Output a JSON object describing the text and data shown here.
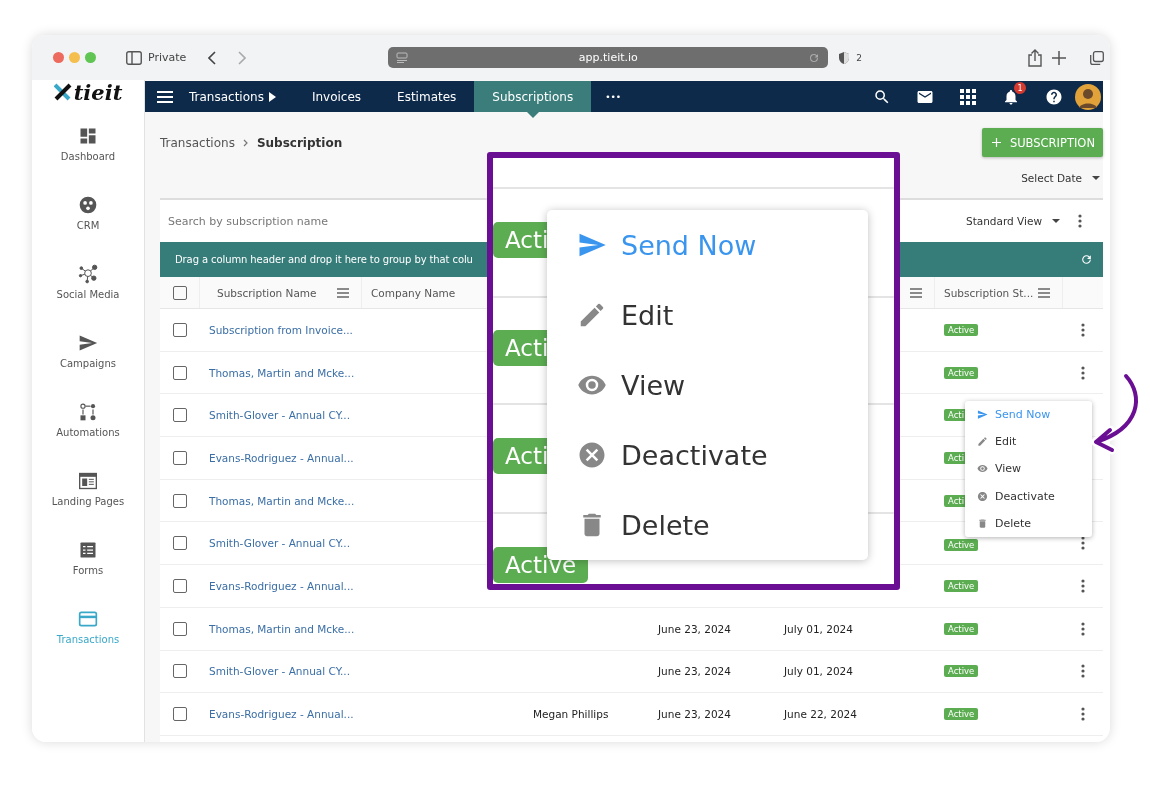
{
  "browser": {
    "private_label": "Private",
    "url": "app.tieit.io",
    "shield_count": "2"
  },
  "logo": {
    "text": "tieit"
  },
  "nav": {
    "tabs": [
      {
        "label": "Transactions",
        "kind": "dropdown",
        "selected": false
      },
      {
        "label": "Invoices",
        "kind": "plain",
        "selected": false
      },
      {
        "label": "Estimates",
        "kind": "plain",
        "selected": false
      },
      {
        "label": "Subscriptions",
        "kind": "plain",
        "selected": true
      },
      {
        "label": "•••",
        "kind": "more",
        "selected": false
      }
    ],
    "icons": [
      {
        "kind": "search"
      },
      {
        "kind": "mail"
      },
      {
        "kind": "apps"
      },
      {
        "kind": "bell",
        "badge": "1"
      },
      {
        "kind": "help"
      },
      {
        "kind": "avatar"
      }
    ]
  },
  "sidebar": {
    "items": [
      {
        "label": "Dashboard",
        "kind": "dashboard",
        "selected": false
      },
      {
        "label": "CRM",
        "kind": "crm",
        "selected": false
      },
      {
        "label": "Social Media",
        "kind": "social",
        "selected": false
      },
      {
        "label": "Campaigns",
        "kind": "campaigns",
        "selected": false
      },
      {
        "label": "Automations",
        "kind": "automations",
        "selected": false
      },
      {
        "label": "Landing Pages",
        "kind": "landing",
        "selected": false
      },
      {
        "label": "Forms",
        "kind": "forms",
        "selected": false
      },
      {
        "label": "Transactions",
        "kind": "transactions",
        "selected": true
      }
    ]
  },
  "breadcrumb": [
    "Transactions",
    "Subscription"
  ],
  "add_button": {
    "label": "SUBSCRIPTION"
  },
  "date_filter": {
    "label": "Select Date"
  },
  "search": {
    "placeholder": "Search by subscription name"
  },
  "view_select": {
    "label": "Standard View"
  },
  "group_bar": {
    "text": "Drag a column header and drop it here to group by that colu"
  },
  "table": {
    "select_all": {
      "checked": false
    },
    "columns": [
      {
        "label": "Subscription Name",
        "menu": true
      },
      {
        "label": "Company Name"
      },
      {
        "menu": true
      },
      {
        "label": "Subscription St...",
        "menu": true
      }
    ],
    "rows": [
      {
        "checked": false,
        "subscription_name": "Subscription from Invoice...",
        "status": "Active",
        "menu_button": true
      },
      {
        "checked": false,
        "subscription_name": "Thomas, Martin and Mcke...",
        "status": "Active",
        "menu_button": true
      },
      {
        "checked": false,
        "subscription_name": "Smith-Glover - Annual CY...",
        "status": "Acti"
      },
      {
        "checked": false,
        "subscription_name": "Evans-Rodriguez - Annual...",
        "status": "Acti"
      },
      {
        "checked": false,
        "subscription_name": "Thomas, Martin and Mcke...",
        "status": "Acti"
      },
      {
        "checked": false,
        "subscription_name": "Smith-Glover - Annual CY...",
        "status": "Active",
        "menu_button": true
      },
      {
        "checked": false,
        "subscription_name": "Evans-Rodriguez - Annual...",
        "status": "Active",
        "menu_button": true
      },
      {
        "checked": false,
        "subscription_name": "Thomas, Martin and Mcke...",
        "column_5": "June 23, 2024",
        "column_6": "July 01, 2024",
        "status": "Active",
        "menu_button": true
      },
      {
        "checked": false,
        "subscription_name": "Smith-Glover - Annual CY...",
        "column_5": "June 23, 2024",
        "column_6": "July 01, 2024",
        "status": "Active",
        "menu_button": true
      },
      {
        "checked": false,
        "subscription_name": "Evans-Rodriguez - Annual...",
        "column_4": "Megan Phillips",
        "column_5": "June 23, 2024",
        "column_6": "June 22, 2024",
        "status": "Active",
        "menu_button": true
      }
    ]
  },
  "row_menu": {
    "items": [
      {
        "label": "Send Now",
        "kind": "send",
        "highlighted": true
      },
      {
        "label": "Edit",
        "kind": "edit",
        "highlighted": false
      },
      {
        "label": "View",
        "kind": "view",
        "highlighted": false
      },
      {
        "label": "Deactivate",
        "kind": "deactivate",
        "highlighted": false
      },
      {
        "label": "Delete",
        "kind": "delete",
        "highlighted": false
      }
    ]
  },
  "zoom_callout": {
    "badges": [
      "Acti",
      "Acti",
      "Acti",
      "Active"
    ],
    "menu": [
      {
        "label": "Send Now",
        "kind": "send",
        "highlighted": true
      },
      {
        "label": "Edit",
        "kind": "edit",
        "highlighted": false
      },
      {
        "label": "View",
        "kind": "view",
        "highlighted": false
      },
      {
        "label": "Deactivate",
        "kind": "deactivate",
        "highlighted": false
      },
      {
        "label": "Delete",
        "kind": "delete",
        "highlighted": false
      }
    ]
  }
}
